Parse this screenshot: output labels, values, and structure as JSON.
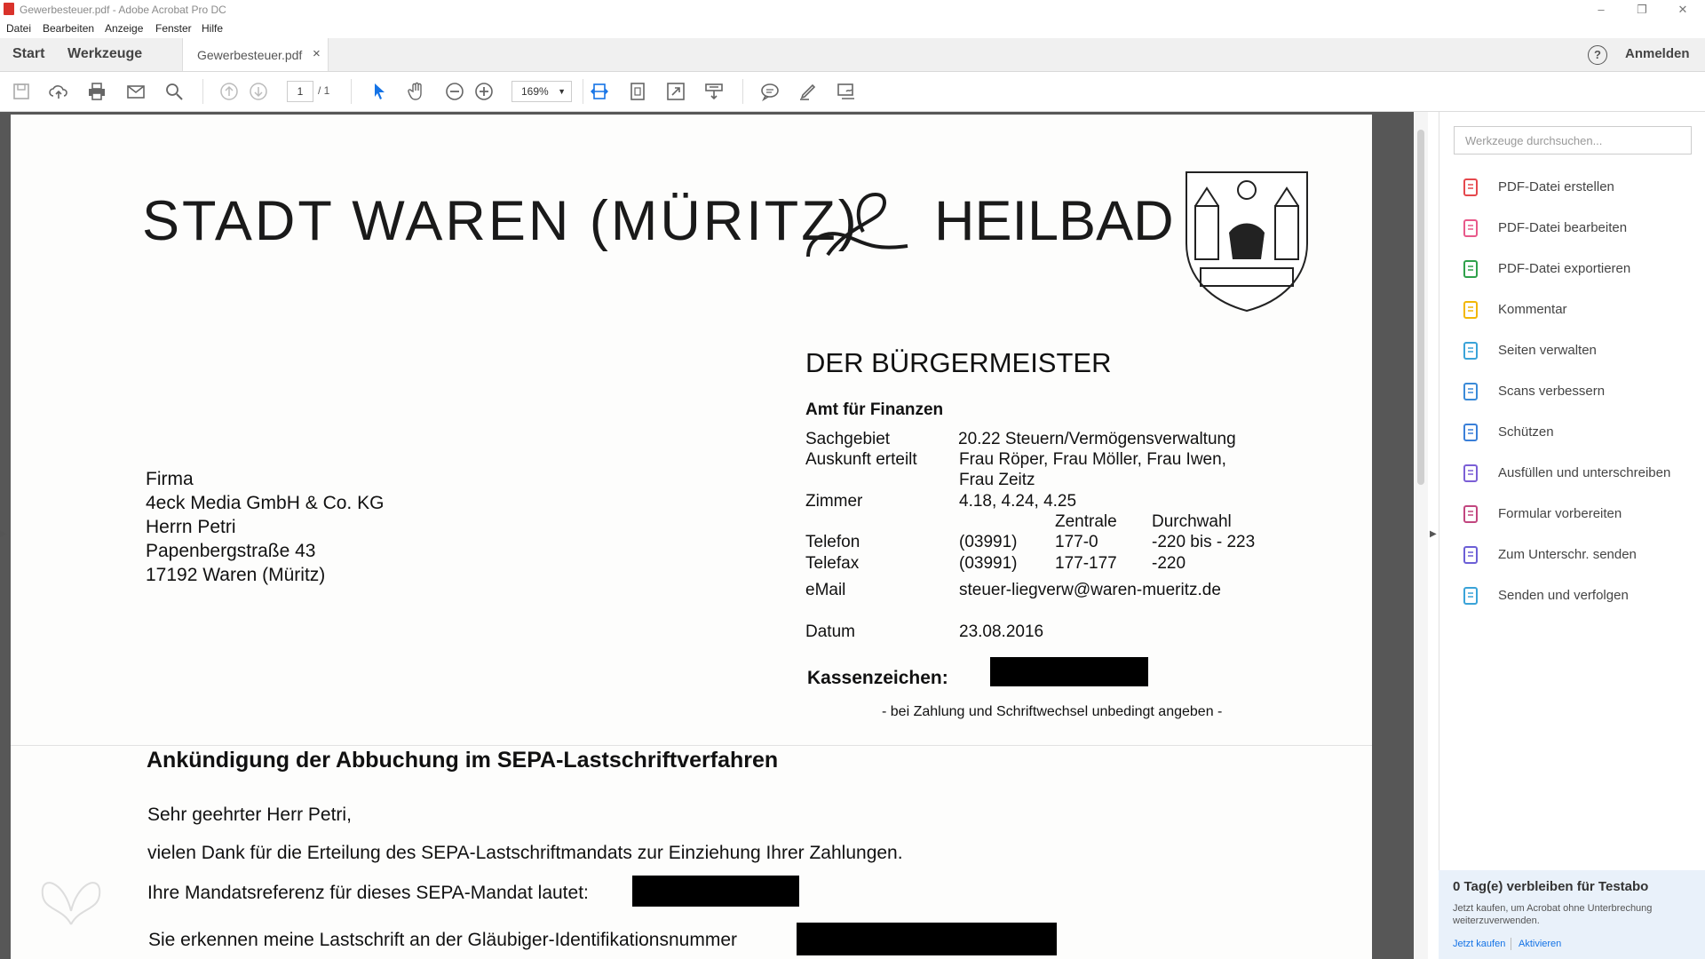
{
  "window": {
    "title": "Gewerbesteuer.pdf - Adobe Acrobat Pro DC",
    "minimize": "–",
    "restore": "❐",
    "close": "✕"
  },
  "menu": [
    "Datei",
    "Bearbeiten",
    "Anzeige",
    "Fenster",
    "Hilfe"
  ],
  "tabs": {
    "start": "Start",
    "werkzeuge": "Werkzeuge",
    "document": "Gewerbesteuer.pdf",
    "close": "×",
    "help": "?",
    "signin": "Anmelden"
  },
  "toolbar": {
    "page_current": "1",
    "page_total": "/ 1",
    "zoom": "169%",
    "zoom_caret": "▼",
    "icons": [
      "save-icon",
      "upload-icon",
      "print-icon",
      "email-icon",
      "search-icon",
      "page-up-icon",
      "page-down-icon",
      "select-cursor-icon",
      "hand-icon",
      "zoom-out-icon",
      "zoom-in-icon",
      "fit-width-icon",
      "fit-page-icon",
      "fullscreen-icon",
      "scroll-mode-icon",
      "comment-icon",
      "highlight-pen-icon",
      "sign-icon"
    ]
  },
  "letter": {
    "header": "STADT WAREN (MÜRITZ)",
    "header_right": "HEILBAD",
    "office": "DER BÜRGERMEISTER",
    "department": "Amt für Finanzen",
    "recipient": [
      "Firma",
      "4eck Media GmbH & Co. KG",
      "Herrn Petri",
      "Papenbergstraße 43",
      "17192 Waren (Müritz)"
    ],
    "info": {
      "sachgebiet_label": "Sachgebiet",
      "sachgebiet_value": "20.22  Steuern/Vermögensverwaltung",
      "auskunft_label": "Auskunft erteilt",
      "auskunft_value1": "Frau Röper, Frau Möller, Frau Iwen,",
      "auskunft_value2": "Frau Zeitz",
      "zimmer_label": "Zimmer",
      "zimmer_value": "4.18, 4.24, 4.25",
      "col_zentrale": "Zentrale",
      "col_durchwahl": "Durchwahl",
      "telefon_label": "Telefon",
      "telefon_vorwahl": "(03991)",
      "telefon_zentrale": "177-0",
      "telefon_durchwahl": "-220 bis - 223",
      "telefax_label": "Telefax",
      "telefax_vorwahl": "(03991)",
      "telefax_zentrale": "177-177",
      "telefax_durchwahl": "-220",
      "email_label": "eMail",
      "email_value": "steuer-liegverw@waren-mueritz.de",
      "datum_label": "Datum",
      "datum_value": "23.08.2016",
      "kassenzeichen_label": "Kassenzeichen:",
      "kassenzeichen_note": "- bei Zahlung und Schriftwechsel unbedingt angeben -"
    },
    "subject": "Ankündigung der Abbuchung im SEPA-Lastschriftverfahren",
    "salutation": "Sehr geehrter Herr Petri,",
    "line1": "vielen Dank für die Erteilung des SEPA-Lastschriftmandats zur Einziehung Ihrer Zahlungen.",
    "line2": "Ihre Mandatsreferenz für dieses SEPA-Mandat lautet:",
    "line3": "Sie erkennen meine Lastschrift an der Gläubiger-Identifikationsnummer"
  },
  "right_pane": {
    "search_placeholder": "Werkzeuge durchsuchen...",
    "tools": [
      {
        "label": "PDF-Datei erstellen",
        "icon": "create-pdf-icon",
        "color": "#e5484d"
      },
      {
        "label": "PDF-Datei bearbeiten",
        "icon": "edit-pdf-icon",
        "color": "#e8598a"
      },
      {
        "label": "PDF-Datei exportieren",
        "icon": "export-pdf-icon",
        "color": "#2fa14b"
      },
      {
        "label": "Kommentar",
        "icon": "comment-icon",
        "color": "#f2b705"
      },
      {
        "label": "Seiten verwalten",
        "icon": "organize-pages-icon",
        "color": "#3aa3d8"
      },
      {
        "label": "Scans verbessern",
        "icon": "enhance-scans-icon",
        "color": "#3a8ad8"
      },
      {
        "label": "Schützen",
        "icon": "protect-shield-icon",
        "color": "#3a7fd8"
      },
      {
        "label": "Ausfüllen und unterschreiben",
        "icon": "fill-sign-icon",
        "color": "#7b5fd6"
      },
      {
        "label": "Formular vorbereiten",
        "icon": "prepare-form-icon",
        "color": "#c2467f"
      },
      {
        "label": "Zum Unterschr. senden",
        "icon": "send-for-signature-icon",
        "color": "#6c5fd6"
      },
      {
        "label": "Senden und verfolgen",
        "icon": "send-track-icon",
        "color": "#3aa3d8"
      }
    ],
    "trial": {
      "title": "0 Tag(e) verbleiben für Testabo",
      "text": "Jetzt kaufen, um Acrobat ohne Unterbrechung weiterzuverwenden.",
      "buy": "Jetzt kaufen",
      "activate": "Aktivieren"
    }
  },
  "colors": {
    "accent": "#1473e6",
    "doc_bg": "#575757",
    "trial_bg": "#e9f1fa"
  }
}
